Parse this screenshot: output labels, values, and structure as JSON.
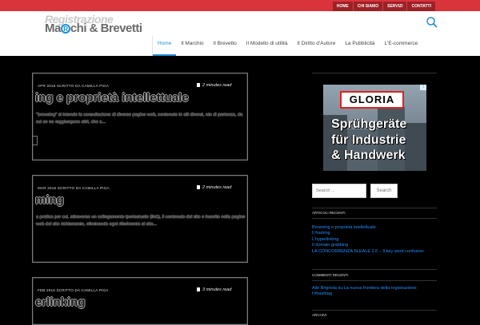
{
  "topnav": [
    "HOME",
    "CHI SIAMO",
    "SERVIZI",
    "CONTATTI"
  ],
  "logo": {
    "top": "Registrazione",
    "left": "Ma",
    "mark": "R",
    "right": "chi & Brevetti"
  },
  "mainnav": [
    "Home",
    "Il Marchio",
    "Il Brevetto",
    "Il Modello di utilità",
    "Il Diritto d'Autore",
    "La Pubblicità",
    "L'E-commerce"
  ],
  "posts": [
    {
      "meta": "APR 2016 SCRITTO DA CAMILLA PIGA",
      "readtime": "2 minutes read",
      "title": "ing e proprietà intellettuale",
      "excerpt": "\"browsing\" si intende la consultazione di diverse pagine web, contenute in siti diversi, nto di partenza, da cui se ne raggiungono altri, che a..."
    },
    {
      "meta": "MAR 2016 SCRITTO DA CAMILLA PIGA",
      "readtime": "2 minutes read",
      "title": "ming",
      "excerpt": "a pratica per cui, attraverso un collegamento ipertestuale (link), il contenuto del sito e inserito nella pagine web del sito richiamante, eliminando ogni riferimento al sito..."
    },
    {
      "meta": "FEB 2016 SCRITTO DA CAMILLA PIGA",
      "readtime": "3 minutes read",
      "title": "erlinking",
      "excerpt": ""
    }
  ],
  "ad": {
    "brand": "GLORIA",
    "line1": "Sprühgeräte",
    "line2": "für Industrie",
    "line3": "& Handwerk",
    "mark": "i"
  },
  "search": {
    "placeholder": "Search ...",
    "button": "Search"
  },
  "recent": {
    "title": "ARTICOLI RECENTI",
    "items": [
      "Browsing e proprietà intellettuale",
      "Il framing",
      "L'hyperlinking",
      "Il domain grabbing",
      "LA CONCORRENZA SLEALE 2.0 – Il key word confusion"
    ]
  },
  "comments": {
    "title": "COMMENTI RECENTI",
    "text": "Alle Brignola su La nuova frontiera della registrazione: l'#hashtag"
  },
  "bottom_title": "ARCHIVI",
  "colors": {
    "topbar": "#d9333b",
    "accent": "#1c8fd6",
    "link": "#1e90ff"
  }
}
